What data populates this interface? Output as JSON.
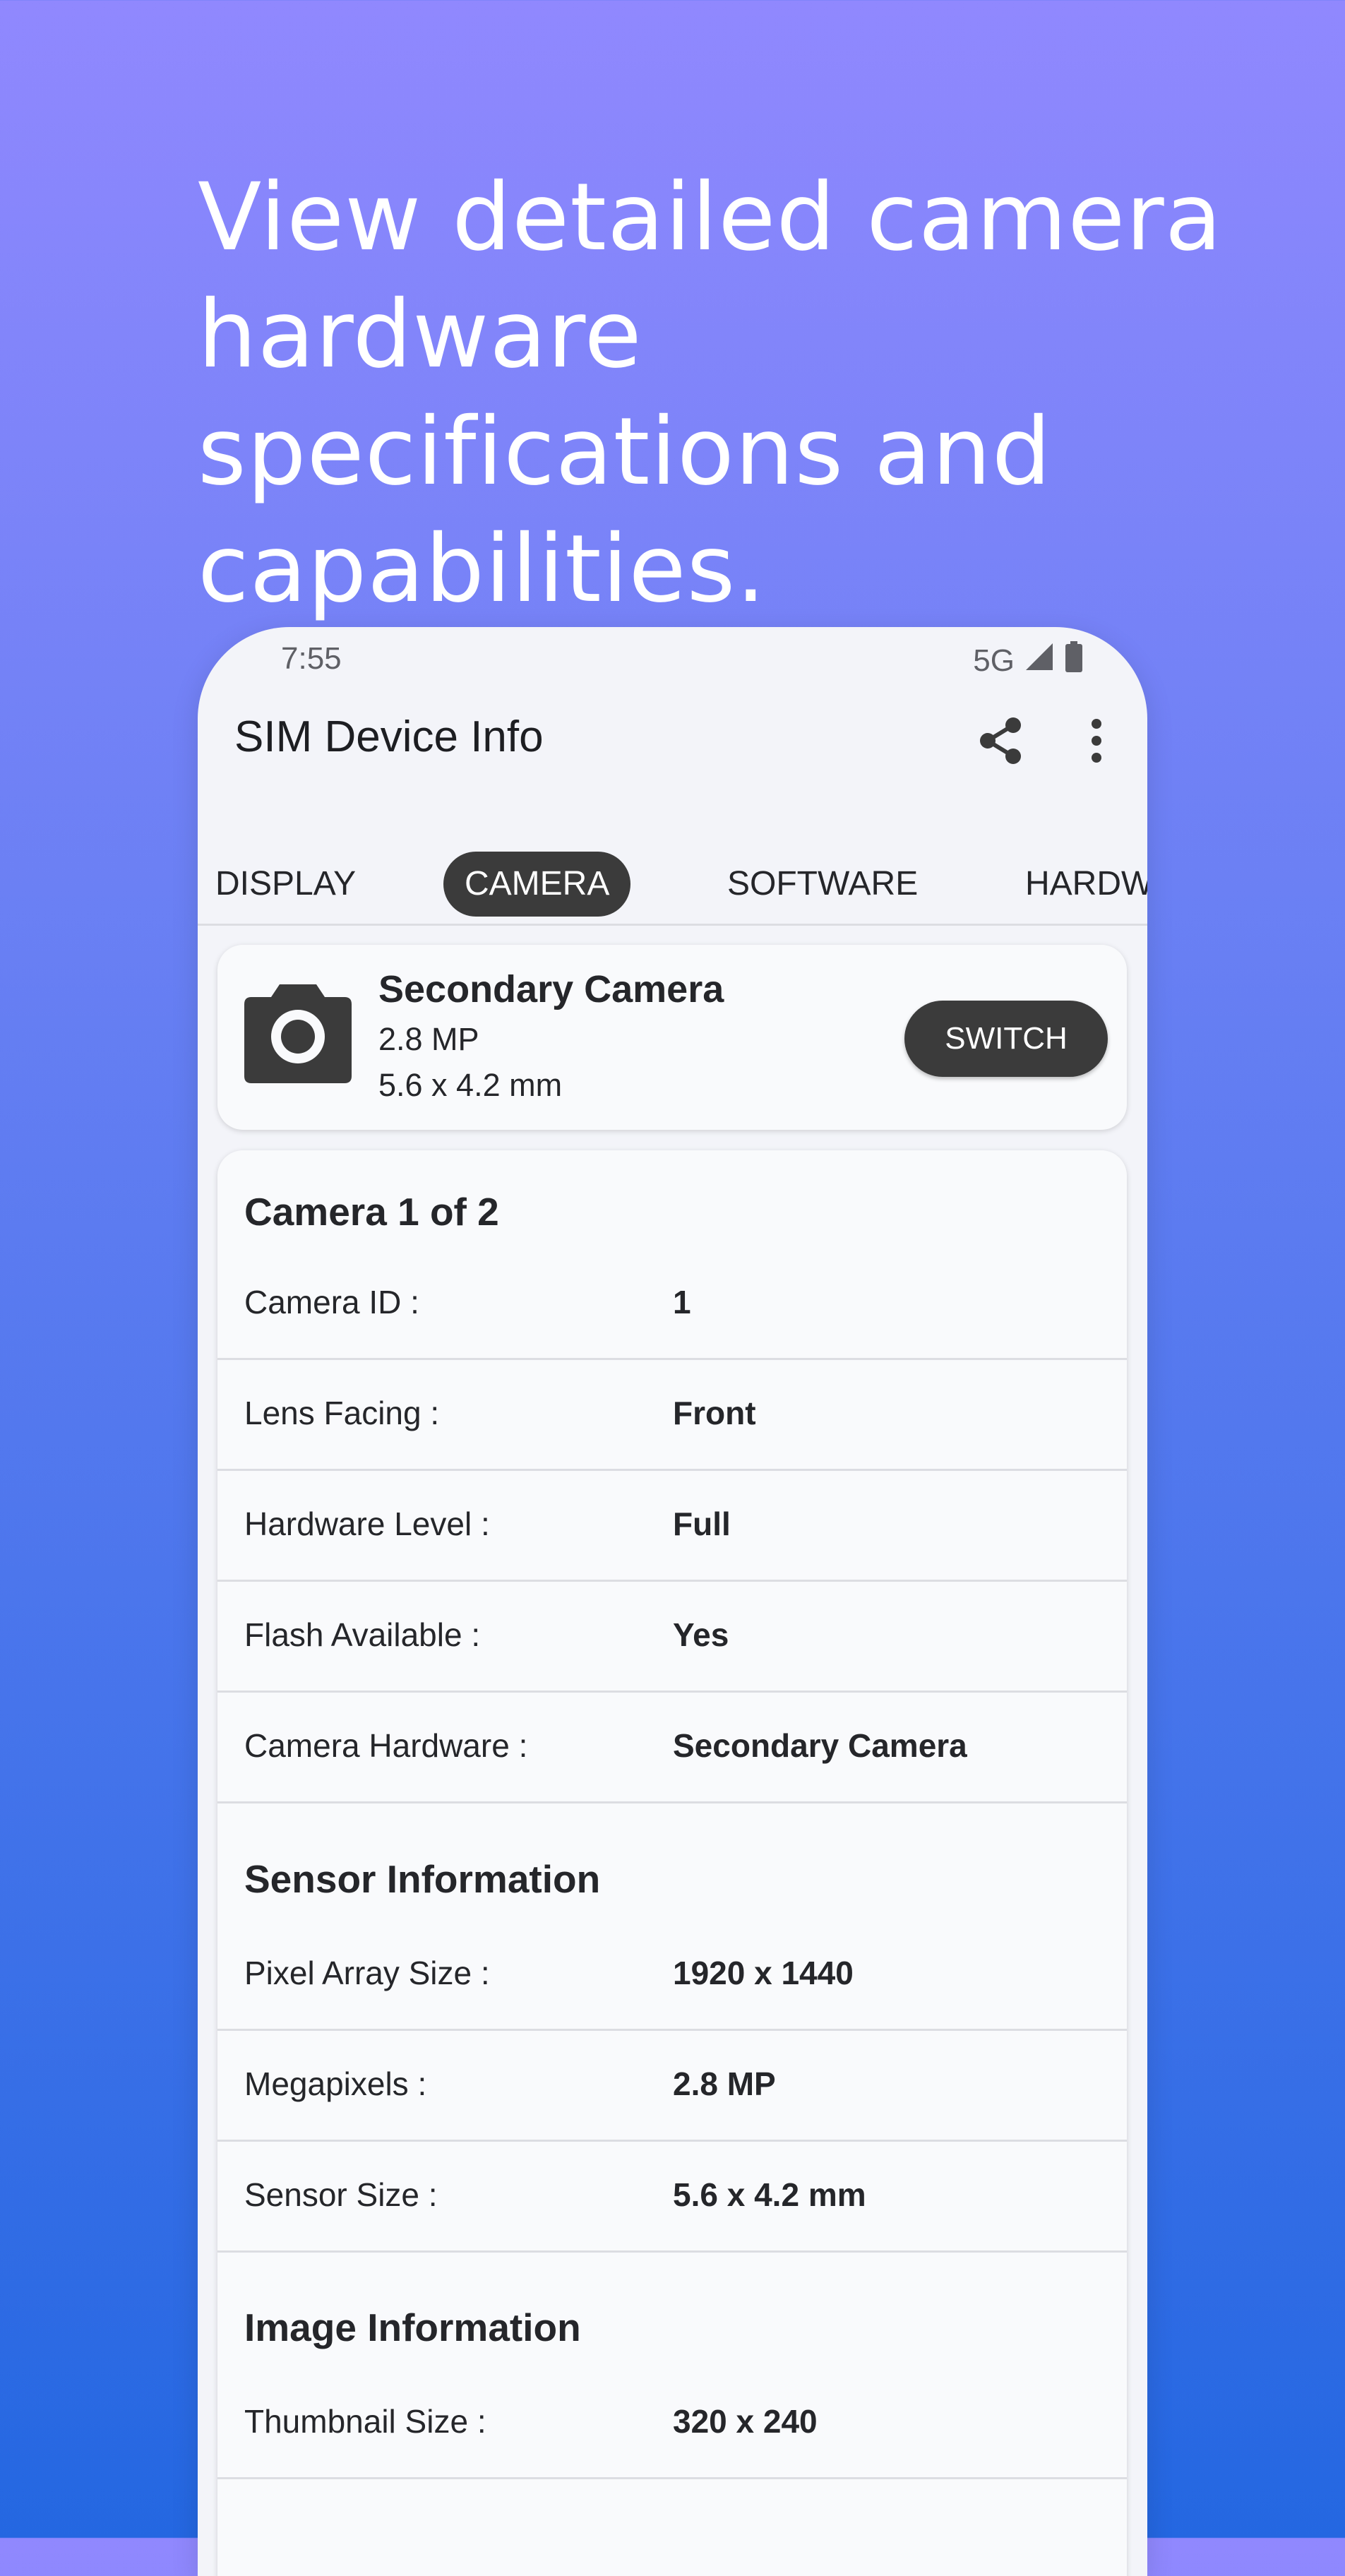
{
  "headline": "View detailed camera hardware specifications and capabilities.",
  "status": {
    "time": "7:55",
    "network": "5G"
  },
  "app": {
    "title": "SIM Device Info"
  },
  "icons": {
    "share": "share-icon",
    "more": "more-vert-icon",
    "camera": "camera-icon",
    "signal": "signal-icon",
    "battery": "battery-icon"
  },
  "tabs": [
    {
      "label": "DISPLAY"
    },
    {
      "label": "CAMERA",
      "active": true
    },
    {
      "label": "SOFTWARE"
    },
    {
      "label": "HARDW"
    }
  ],
  "camera_card": {
    "name": "Secondary Camera",
    "megapixels": "2.8 MP",
    "size": "5.6 x 4.2 mm",
    "switch_label": "SWITCH"
  },
  "details": {
    "camera_title": "Camera 1 of 2",
    "basic": [
      {
        "label": "Camera ID :",
        "value": "1"
      },
      {
        "label": "Lens Facing :",
        "value": "Front"
      },
      {
        "label": "Hardware Level :",
        "value": "Full"
      },
      {
        "label": "Flash Available :",
        "value": "Yes"
      },
      {
        "label": "Camera Hardware :",
        "value": "Secondary Camera"
      }
    ],
    "sensor_title": "Sensor Information",
    "sensor": [
      {
        "label": "Pixel Array Size :",
        "value": "1920 x 1440"
      },
      {
        "label": "Megapixels :",
        "value": "2.8 MP"
      },
      {
        "label": "Sensor Size :",
        "value": "5.6 x 4.2 mm"
      }
    ],
    "image_title": "Image Information",
    "image": [
      {
        "label": "Thumbnail Size :",
        "value": "320 x 240"
      }
    ]
  },
  "colors": {
    "accent_dark": "#3b3b3b",
    "bg_top": "#9088fe",
    "bg_bottom": "#2467e1"
  }
}
